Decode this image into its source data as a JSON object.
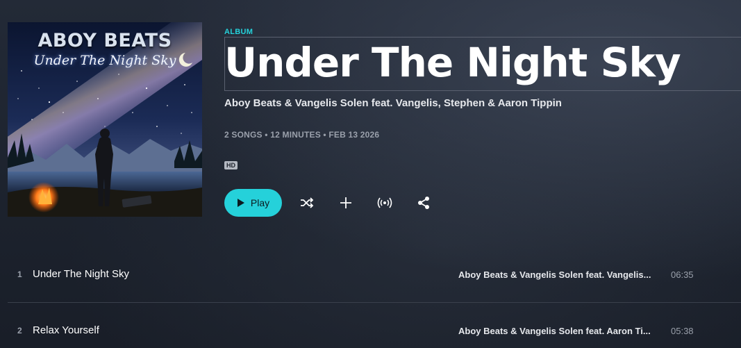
{
  "album": {
    "cover": {
      "title": "ABOY BEATS",
      "subtitle": "Under The Night Sky"
    },
    "type_label": "ALBUM",
    "title": "Under The Night Sky",
    "artists": "Aboy Beats & Vangelis Solen feat. Vangelis, Stephen & Aaron Tippin",
    "meta": "2 SONGS • 12 MINUTES • FEB 13 2026",
    "quality_badge": "HD"
  },
  "controls": {
    "play_label": "Play",
    "play_icon": "play-icon",
    "shuffle_icon": "shuffle-icon",
    "add_icon": "plus-icon",
    "radio_icon": "broadcast-icon",
    "share_icon": "share-icon"
  },
  "tracks": [
    {
      "number": "1",
      "title": "Under The Night Sky",
      "artists": "Aboy Beats & Vangelis Solen feat. Vangelis...",
      "duration": "06:35"
    },
    {
      "number": "2",
      "title": "Relax Yourself",
      "artists": "Aboy Beats & Vangelis Solen feat. Aaron Ti...",
      "duration": "05:38"
    }
  ],
  "colors": {
    "accent": "#25d1da",
    "background": "#1c222d",
    "muted_text": "#9aa0ab"
  }
}
